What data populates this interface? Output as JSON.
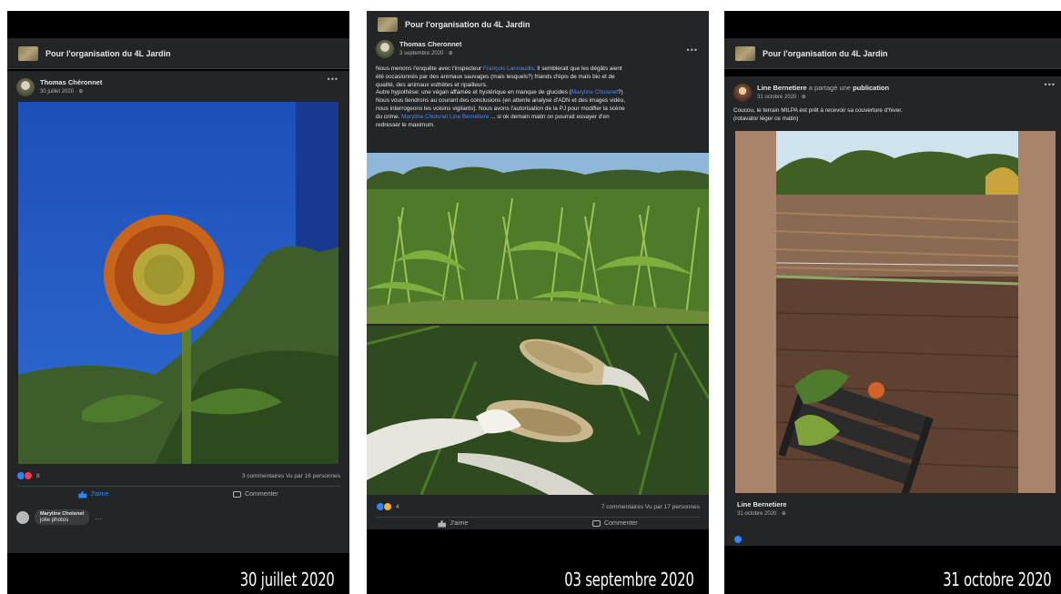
{
  "posts": [
    {
      "group": "Pour l'organisation du 4L Jardin",
      "author": "Thomas Chéronnet",
      "date": "30 juillet 2020 · ⊕",
      "photo_icon": "sunflower-photo",
      "reaction_count": "8",
      "stats": "3 commentaires  Vu par 16 personnes",
      "like_label": "J'aime",
      "comment_label": "Commenter",
      "comment": {
        "name": "Maryline Choisnet",
        "text": "jolie photos"
      },
      "caption": "30 juillet 2020"
    },
    {
      "group": "Pour l'organisation du 4L Jardin",
      "author": "Thomas Cheronnet",
      "date": "3 septembre 2020 · ⊕",
      "text_lines": [
        {
          "before": "Nous menons l'enquête avec l'inspecteur ",
          "link": "François Lannaudis",
          "after": ". Il semblerait que les dégâts aient"
        },
        {
          "before": "été occasionnés par des animaux sauvages (mais lesquels?) friands d'épis de maïs bio et de",
          "link": "",
          "after": ""
        },
        {
          "before": "qualité, des animaux esthètes et ripailleurs.",
          "link": "",
          "after": ""
        },
        {
          "before": "Autre hypothèse: une végan affamée et hystérique en manque de glucides (",
          "link": "Maryline Choisnet",
          "after": "?)"
        },
        {
          "before": "Nous vous tiendrons au courant des conclusions (en attente analyse d'ADN et des images vidéo,",
          "link": "",
          "after": ""
        },
        {
          "before": "nous interrogeons les voisins vigilants). Nous avons l'autorisation de la PJ pour modifier la scène",
          "link": "",
          "after": ""
        },
        {
          "before": "du crime. ",
          "link": "Maryline Choisnet Line Bernetiere",
          "after": " ... si ok demain matin on pourrait essayer d'en"
        },
        {
          "before": "redresser le maximum.",
          "link": "",
          "after": ""
        }
      ],
      "reaction_count": "4",
      "stats": "7 commentaires  Vu par 17 personnes",
      "like_label": "J'aime",
      "comment_label": "Commenter",
      "caption": "03 septembre 2020"
    },
    {
      "group": "Pour l'organisation du 4L Jardin",
      "author": "Line Bernetiere",
      "shared_prefix": " a partagé une ",
      "shared_object": "publication",
      "date": "31 octobre 2020 · ⊕",
      "text_lines": [
        "Coucou, le terrain MILPA est prêt à recevoir sa couverture d'hiver.",
        "(rotavator léger ce matin)"
      ],
      "inner_author": "Line Bernetiere",
      "inner_date": "31 octobre 2020 · ⊕",
      "caption": "31 octobre 2020"
    }
  ],
  "colors": {
    "fb_card": "#242526",
    "fb_text": "#e4e6eb",
    "fb_link": "#4b8bf5",
    "like_blue": "#2d88ff"
  }
}
